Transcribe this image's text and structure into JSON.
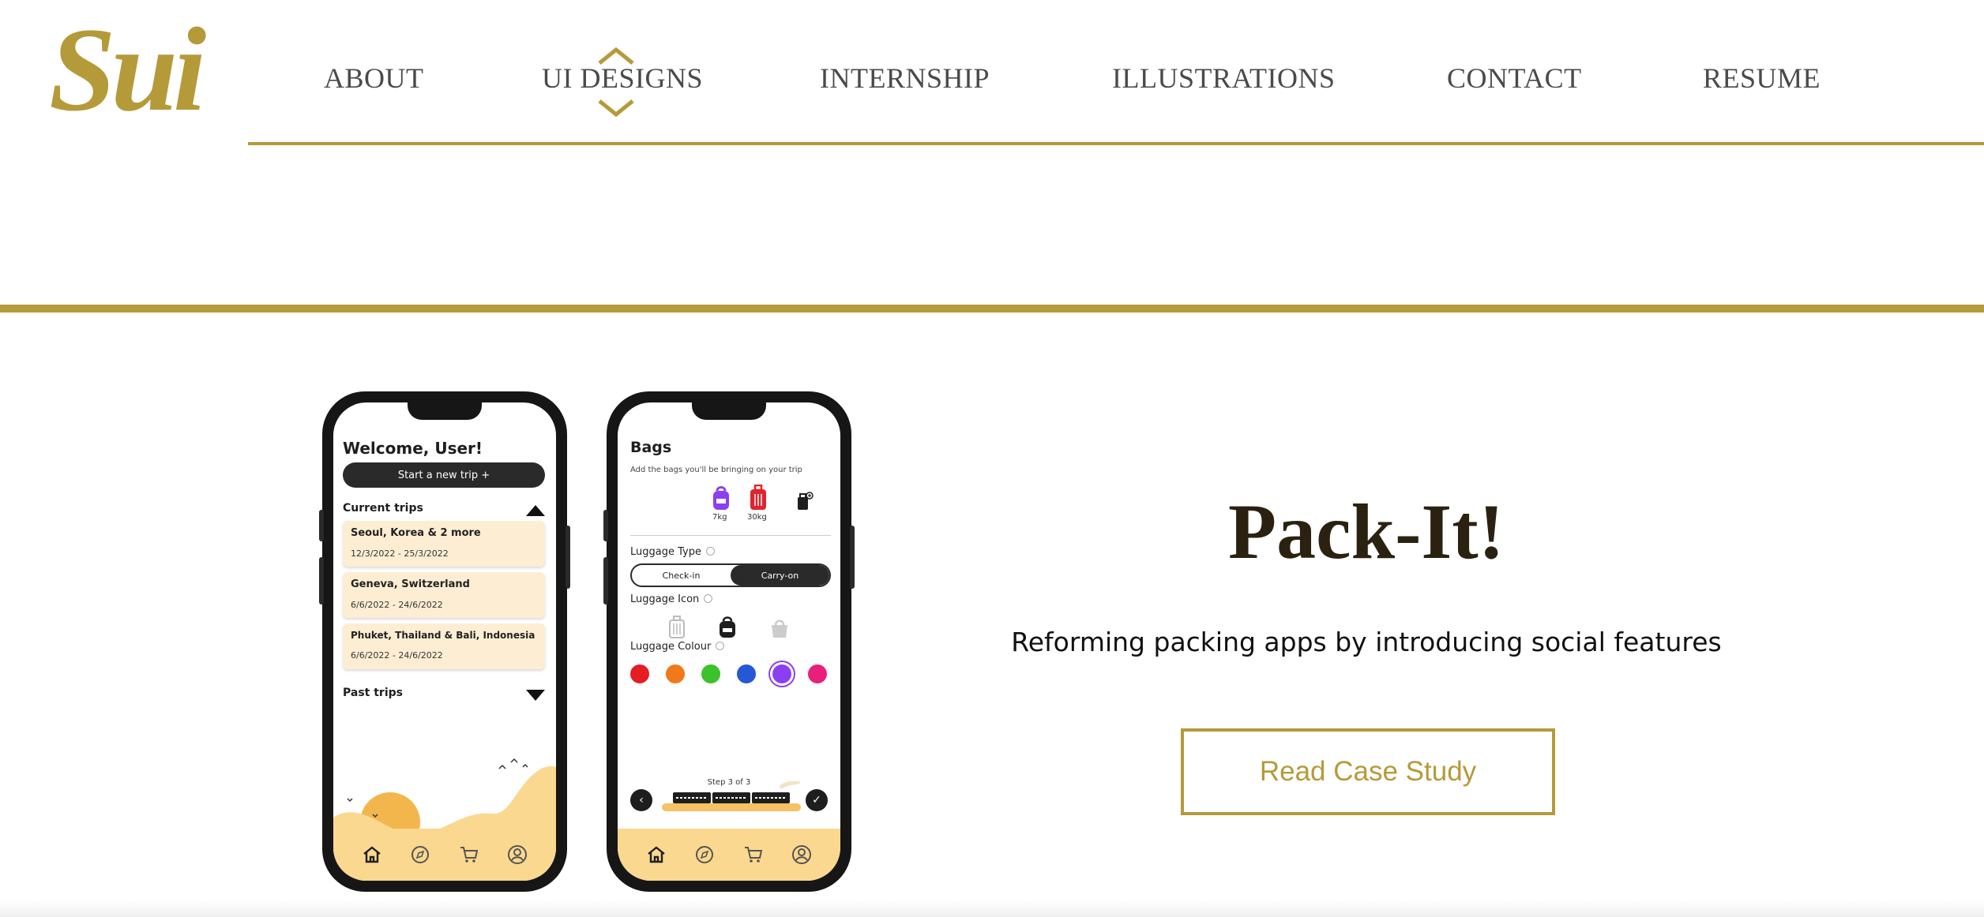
{
  "logo": {
    "text": "Sui"
  },
  "nav": {
    "items": [
      {
        "label": "ABOUT"
      },
      {
        "label": "UI DESIGNS"
      },
      {
        "label": "INTERNSHIP"
      },
      {
        "label": "ILLUSTRATIONS"
      },
      {
        "label": "CONTACT"
      },
      {
        "label": "RESUME"
      }
    ],
    "active": "UI DESIGNS"
  },
  "phone_home": {
    "title": "Welcome, User!",
    "start_button": "Start a new trip  +",
    "current_trips_label": "Current trips",
    "trips": [
      {
        "name": "Seoul, Korea & 2 more",
        "dates": "12/3/2022 - 25/3/2022"
      },
      {
        "name": "Geneva, Switzerland",
        "dates": "6/6/2022 - 24/6/2022"
      },
      {
        "name": "Phuket, Thailand & Bali, Indonesia",
        "dates": "6/6/2022 - 24/6/2022"
      }
    ],
    "past_trips_label": "Past trips"
  },
  "phone_bags": {
    "title": "Bags",
    "subtitle": "Add the bags you'll be bringing on your trip",
    "bags": [
      {
        "weight": "7kg",
        "color": "#8b3ff2"
      },
      {
        "weight": "30kg",
        "color": "#e0242b"
      }
    ],
    "luggage_type_label": "Luggage Type",
    "luggage_type_options": [
      "Check-in",
      "Carry-on"
    ],
    "luggage_type_selected": "Carry-on",
    "luggage_icon_label": "Luggage Icon",
    "luggage_colour_label": "Luggage Colour",
    "colours": [
      "#e61c24",
      "#f07a1a",
      "#3cc22a",
      "#2557d6",
      "#8b3ff2",
      "#e8207a"
    ],
    "selected_colour": "#8b3ff2",
    "step_label": "Step 3 of 3"
  },
  "hero": {
    "title": "Pack-It!",
    "subtitle": "Reforming packing apps by introducing social features",
    "cta_label": "Read Case Study"
  },
  "colors": {
    "accent": "#b59a3a",
    "title": "#2b2110",
    "card": "#fdeed3",
    "tabbar": "#fbd88f"
  }
}
